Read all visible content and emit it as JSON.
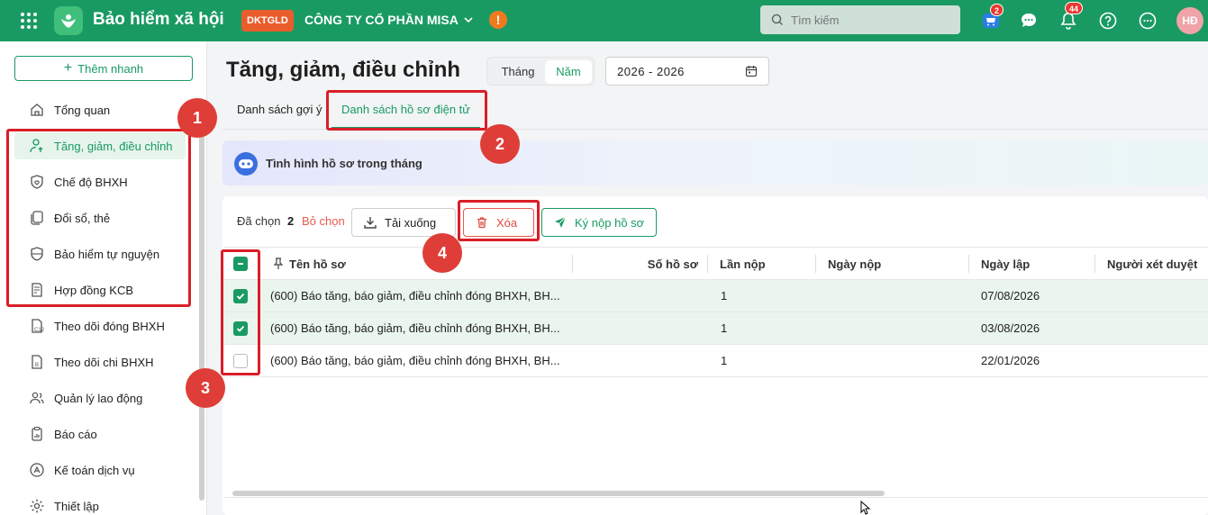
{
  "header": {
    "app_title": "Bảo hiểm xã hội",
    "company_code": "DKTGLD",
    "company_name": "CÔNG TY CỔ PHẦN MISA",
    "warning_mark": "!",
    "search_placeholder": "Tìm kiếm",
    "cart_count": "2",
    "notification_count": "44",
    "avatar_initials": "HĐ"
  },
  "sidebar": {
    "add_button": "Thêm nhanh",
    "items": [
      {
        "label": "Tổng quan",
        "icon": "home-icon"
      },
      {
        "label": "Tăng, giảm, điều chỉnh",
        "icon": "user-up-icon",
        "active": true
      },
      {
        "label": "Chế độ BHXH",
        "icon": "shield-heart-icon"
      },
      {
        "label": "Đổi sổ, thẻ",
        "icon": "copy-card-icon"
      },
      {
        "label": "Bảo hiểm tự nguyện",
        "icon": "shield-icon"
      },
      {
        "label": "Hợp đồng KCB",
        "icon": "contract-icon"
      },
      {
        "label": "Theo dõi đóng BHXH",
        "icon": "c12-doc-icon"
      },
      {
        "label": "Theo dõi chi BHXH",
        "icon": "doc-chi-icon"
      },
      {
        "label": "Quản lý lao động",
        "icon": "users-icon"
      },
      {
        "label": "Báo cáo",
        "icon": "report-icon"
      },
      {
        "label": "Kế toán dịch vụ",
        "icon": "accounting-icon"
      },
      {
        "label": "Thiết lập",
        "icon": "gear-icon"
      }
    ]
  },
  "main": {
    "title": "Tăng, giảm, điều chỉnh",
    "period_toggle": {
      "month": "Tháng",
      "year": "Năm",
      "selected": "Năm"
    },
    "date_range": "2026 - 2026",
    "tabs": [
      {
        "label": "Danh sách gợi ý",
        "active": false
      },
      {
        "label": "Danh sách hồ sơ điện tử",
        "active": true
      }
    ],
    "banner_text": "Tình hình hồ sơ trong tháng",
    "toolbar": {
      "selected_label": "Đã chọn",
      "selected_count": "2",
      "deselect": "Bỏ chọn",
      "download": "Tải xuống",
      "delete": "Xóa",
      "sign_submit": "Ký nộp hồ sơ"
    },
    "table": {
      "columns": [
        "Tên hồ sơ",
        "Số hồ sơ",
        "Lần nộp",
        "Ngày nộp",
        "Ngày lập",
        "Người xét duyệt"
      ],
      "rows": [
        {
          "checked": true,
          "name": "(600) Báo tăng, báo giảm, điều chỉnh đóng BHXH, BH...",
          "so_ho_so": "",
          "lan_nop": "1",
          "ngay_nop": "",
          "ngay_lap": "07/08/2026",
          "nguoi_xet_duyet": ""
        },
        {
          "checked": true,
          "name": "(600) Báo tăng, báo giảm, điều chỉnh đóng BHXH, BH...",
          "so_ho_so": "",
          "lan_nop": "1",
          "ngay_nop": "",
          "ngay_lap": "03/08/2026",
          "nguoi_xet_duyet": ""
        },
        {
          "checked": false,
          "name": "(600) Báo tăng, báo giảm, điều chỉnh đóng BHXH, BH...",
          "so_ho_so": "",
          "lan_nop": "1",
          "ngay_nop": "",
          "ngay_lap": "22/01/2026",
          "nguoi_xet_duyet": ""
        }
      ]
    }
  },
  "callouts": [
    "1",
    "2",
    "3",
    "4"
  ],
  "colors": {
    "brand": "#1a9a63",
    "header": "#1a9a63",
    "danger": "#d91e28",
    "callout": "#df3d38"
  }
}
